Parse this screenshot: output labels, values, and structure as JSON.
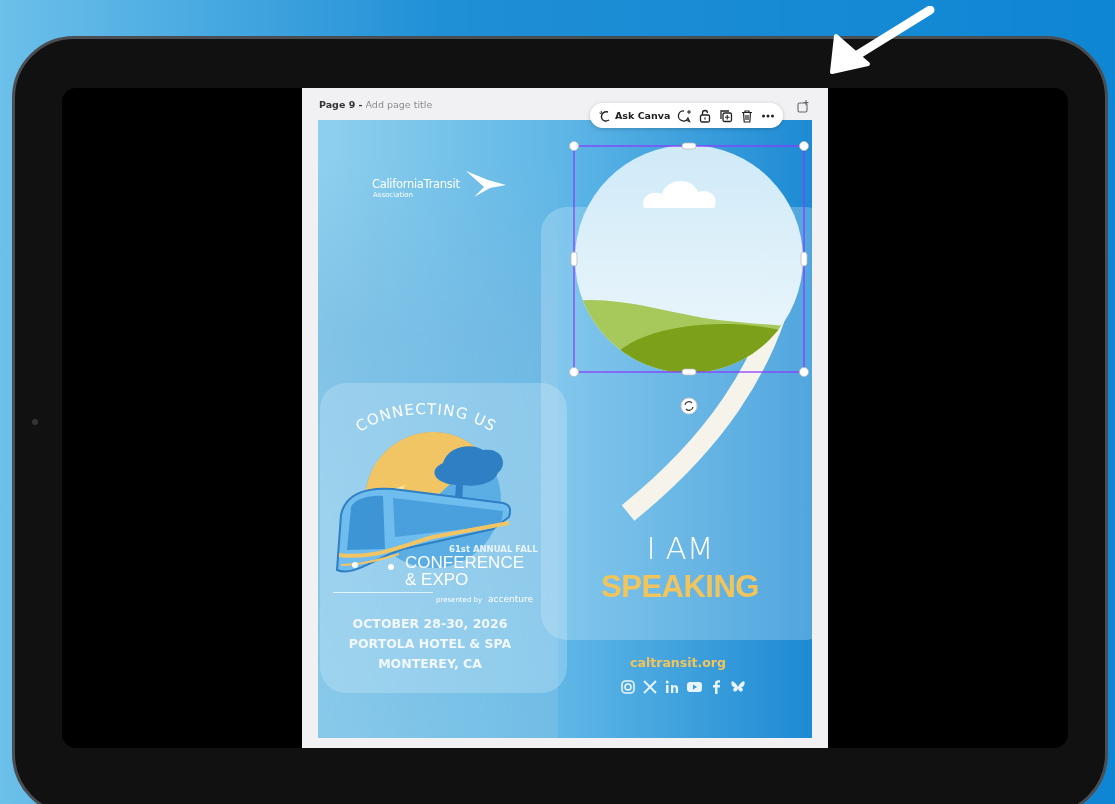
{
  "page_header": {
    "page_label": "Page 9 -",
    "title_field": {
      "placeholder": "Add page title"
    }
  },
  "toolbar": {
    "ask_label": "Ask Canva"
  },
  "poster": {
    "logo": {
      "name": "CaliforniaTransit",
      "subtitle": "Association"
    },
    "event_logo": {
      "arc_text": "CONNECTING US",
      "edition": "61st ANNUAL FALL",
      "title_lines": [
        "CONFERENCE",
        "& EXPO"
      ],
      "sponsor_prefix": "presented by",
      "sponsor": "accenture"
    },
    "details": [
      "OCTOBER 28-30, 2026",
      "PORTOLA HOTEL & SPA",
      "MONTEREY, CA"
    ],
    "headline": [
      "I AM",
      "SPEAKING"
    ],
    "website": "caltransit.org",
    "image_frame": {
      "selected": true
    }
  }
}
